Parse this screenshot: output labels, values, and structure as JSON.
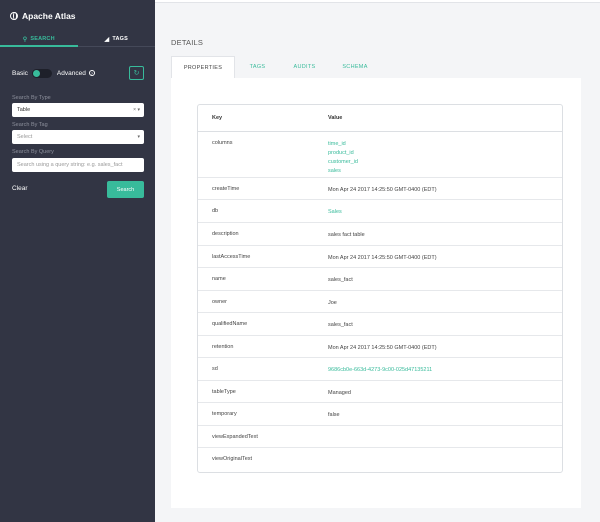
{
  "brand": "Apache Atlas",
  "side_tabs": {
    "search": "SEARCH",
    "tags": "TAGS"
  },
  "toggle": {
    "basic": "Basic",
    "advanced": "Advanced"
  },
  "filters": {
    "type_label": "Search By Type",
    "type_value": "Table",
    "tag_label": "Search By Tag",
    "tag_value": "Select",
    "query_label": "Search By Query",
    "query_placeholder": "Search using a query string: e.g. sales_fact"
  },
  "actions": {
    "clear": "Clear",
    "search": "Search"
  },
  "section_title": "DETAILS",
  "tabs": [
    "PROPERTIES",
    "TAGS",
    "AUDITS",
    "SCHEMA"
  ],
  "table": {
    "headers": {
      "key": "Key",
      "value": "Value"
    },
    "rows": [
      {
        "key": "columns",
        "values": [
          "time_id",
          "product_id",
          "customer_id",
          "sales"
        ],
        "link": true
      },
      {
        "key": "createTime",
        "values": [
          "Mon Apr 24 2017 14:25:50 GMT-0400 (EDT)"
        ],
        "link": false
      },
      {
        "key": "db",
        "values": [
          "Sales"
        ],
        "link": true
      },
      {
        "key": "description",
        "values": [
          "sales fact table"
        ],
        "link": false
      },
      {
        "key": "lastAccessTime",
        "values": [
          "Mon Apr 24 2017 14:25:50 GMT-0400 (EDT)"
        ],
        "link": false
      },
      {
        "key": "name",
        "values": [
          "sales_fact"
        ],
        "link": false
      },
      {
        "key": "owner",
        "values": [
          "Joe"
        ],
        "link": false
      },
      {
        "key": "qualifiedName",
        "values": [
          "sales_fact"
        ],
        "link": false
      },
      {
        "key": "retention",
        "values": [
          "Mon Apr 24 2017 14:25:50 GMT-0400 (EDT)"
        ],
        "link": false
      },
      {
        "key": "sd",
        "values": [
          "9686cb0e-663d-4273-9c00-025d47135211"
        ],
        "link": true
      },
      {
        "key": "tableType",
        "values": [
          "Managed"
        ],
        "link": false
      },
      {
        "key": "temporary",
        "values": [
          "false"
        ],
        "link": false
      },
      {
        "key": "viewExpandedText",
        "values": [
          ""
        ],
        "link": false
      },
      {
        "key": "viewOriginalText",
        "values": [
          ""
        ],
        "link": false
      }
    ]
  },
  "colors": {
    "accent": "#38bb9b",
    "sidebar": "#323544"
  }
}
